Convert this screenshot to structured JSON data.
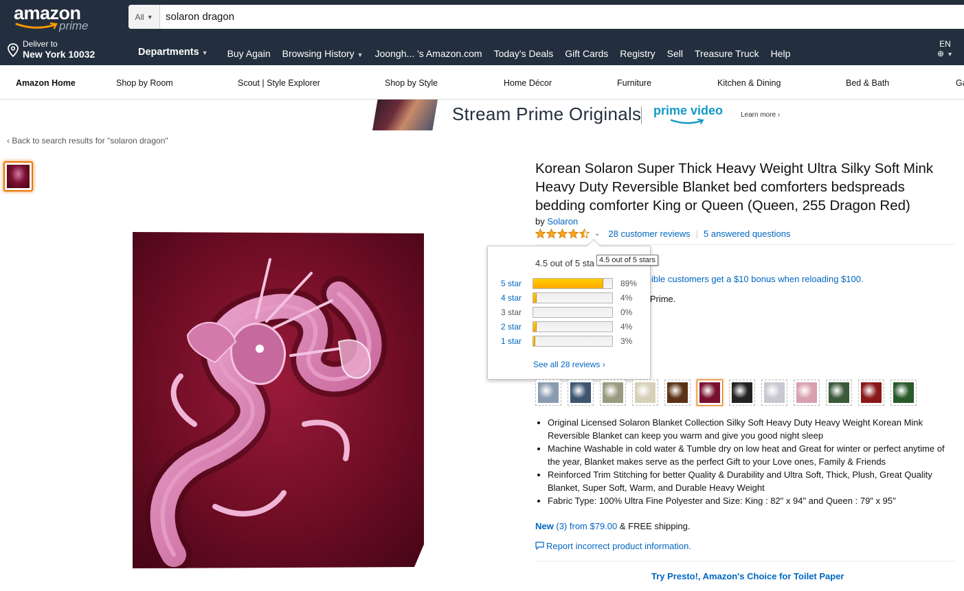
{
  "header": {
    "logo_text": "amazon",
    "logo_sub": "prime",
    "search_dept": "All",
    "search_value": "solaron dragon",
    "deliver_line1": "Deliver to",
    "deliver_line2": "New York 10032",
    "departments": "Departments",
    "nav_links": [
      "Buy Again",
      "Browsing History",
      "Joongh... 's Amazon.com",
      "Today's Deals",
      "Gift Cards",
      "Registry",
      "Sell",
      "Treasure Truck",
      "Help"
    ],
    "lang": "EN"
  },
  "subnav": {
    "items": [
      "Amazon Home",
      "Shop by Room",
      "Scout | Style Explorer",
      "Shop by Style",
      "Home Décor",
      "Furniture",
      "Kitchen & Dining",
      "Bed & Bath",
      "Ga"
    ]
  },
  "banner": {
    "text": "Stream Prime Originals",
    "brand": "prime video",
    "learn_more": "Learn more ›"
  },
  "breadcrumb": {
    "back": "‹ Back to search results for \"solaron dragon\""
  },
  "product": {
    "title": "Korean Solaron Super Thick Heavy Weight Ultra Silky Soft Mink Heavy Duty Reversible Blanket bed comforters bedspreads bedding comforter King or Queen (Queen, 255 Dragon Red)",
    "by_label": "by",
    "brand": "Solaron",
    "rating": 4.5,
    "reviews_link": "28 customer reviews",
    "questions_link": "5 answered questions",
    "partial_text_1": "g",
    "partial_text_2": "ligible customers get a $10 bonus when reloading $100.",
    "partial_text_3": "n Prime.",
    "bullets": [
      "Original Licensed Solaron Blanket Collection Silky Soft Heavy Duty Heavy Weight Korean Mink Reversible Blanket can keep you warm and give you good night sleep",
      "Machine Washable in cold water & Tumble dry on low heat and Great for winter or perfect anytime of the year, Blanket makes serve as the perfect Gift to your Love ones, Family & Friends",
      "Reinforced Trim Stitching for better Quality & Durability and Ultra Soft, Thick, Plush, Great Quality Blanket, Super Soft, Warm, and Durable Heavy Weight",
      "Fabric Type: 100% Ultra Fine Polyester and Size: King : 82\" x 94\" and Queen : 79\" x 95\""
    ],
    "offer_new": "New",
    "offer_count": "(3)",
    "offer_from": "from $79.00",
    "offer_rest": "& FREE shipping.",
    "report": "Report incorrect product information.",
    "presto": "Try Presto!, Amazon's Choice for Toilet Paper"
  },
  "popover": {
    "heading": "4.5 out of 5 sta",
    "tooltip": "4.5 out of 5 stars",
    "histogram": [
      {
        "label": "5 star",
        "pct": "89%",
        "value": 89,
        "link": true
      },
      {
        "label": "4 star",
        "pct": "4%",
        "value": 4,
        "link": true
      },
      {
        "label": "3 star",
        "pct": "0%",
        "value": 0,
        "link": false
      },
      {
        "label": "2 star",
        "pct": "4%",
        "value": 4,
        "link": true
      },
      {
        "label": "1 star",
        "pct": "3%",
        "value": 3,
        "link": true
      }
    ],
    "see_all": "See all 28 reviews ›"
  },
  "swatch_colors": [
    "#8a9bb0",
    "#3d5570",
    "#9a9a80",
    "#d8cfb8",
    "#5a3215",
    "#7a1030",
    "#222222",
    "#c8c8d0",
    "#d8a0b0",
    "#3a5a3a",
    "#8a1818",
    "#2a5a2a"
  ]
}
